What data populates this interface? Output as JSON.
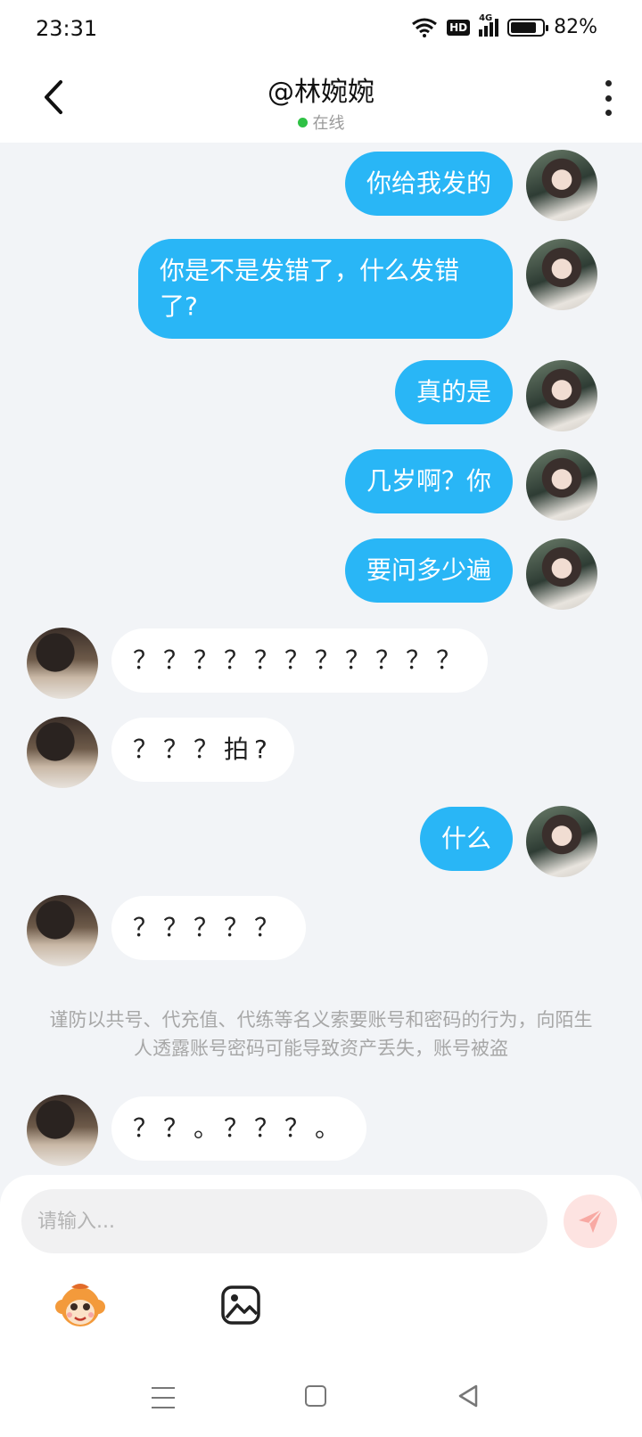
{
  "status": {
    "time": "23:31",
    "hd": "HD",
    "network": "4G",
    "battery_percent_text": "82%",
    "battery_level": 0.82
  },
  "header": {
    "title": "@林婉婉",
    "status_text": "在线"
  },
  "messages": [
    {
      "side": "out",
      "text": "你给我发的"
    },
    {
      "side": "out",
      "text": "你是不是发错了，什么发错了?"
    },
    {
      "side": "out",
      "text": "真的是"
    },
    {
      "side": "out",
      "text": "几岁啊？你"
    },
    {
      "side": "out",
      "text": "要问多少遍"
    },
    {
      "side": "in",
      "text": "？？？？？？？？？？？"
    },
    {
      "side": "in",
      "text": "？？？拍?"
    },
    {
      "side": "out",
      "text": "什么"
    },
    {
      "side": "in",
      "text": "？？？？？"
    },
    {
      "side": "in",
      "text": "？？。？？？。"
    }
  ],
  "notice": "谨防以共号、代充值、代练等名义索要账号和密码的行为，向陌生人透露账号密码可能导致资产丢失，账号被盗",
  "input": {
    "placeholder": "请输入..."
  },
  "colors": {
    "outgoing_bubble": "#29b6f6",
    "incoming_bubble": "#ffffff",
    "online": "#2fc145",
    "send_button": "#fde3e1"
  }
}
